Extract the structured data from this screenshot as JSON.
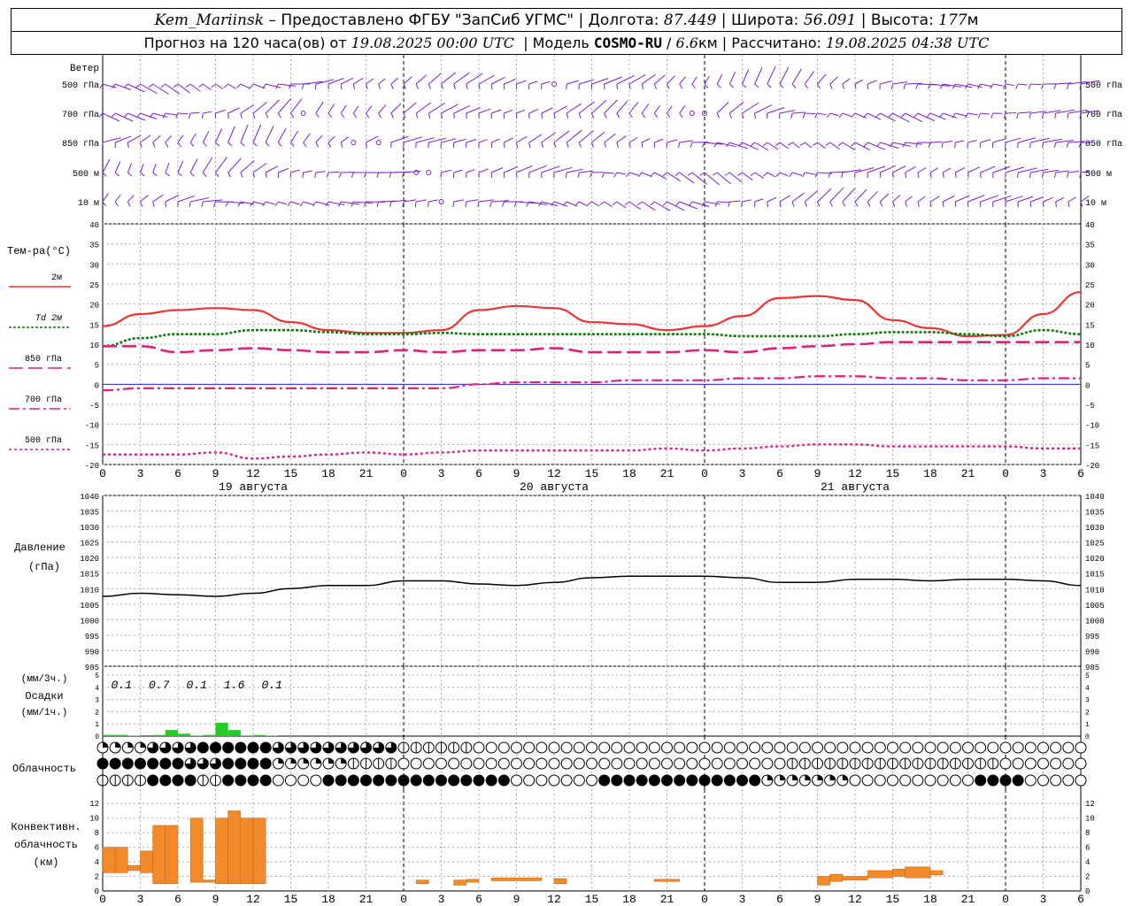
{
  "header": {
    "station": "Kem_Mariinsk",
    "dash": " – Предоставлено ФГБУ \"ЗапСиб УГМС\" | Долгота: ",
    "lon": "87.449",
    "lat_label": " | Широта: ",
    "lat": "56.091",
    "alt_label": " | Высота: ",
    "alt": "177",
    "alt_unit": "м",
    "forecast_label": "Прогноз на 120 часа(ов) от ",
    "start": "19.08.2025 00:00 UTC",
    "model_label": "  | Модель ",
    "model": "COSMO-RU",
    "res_sep": " / ",
    "res": "6.6",
    "res_unit": "км",
    "calc_label": " | Рассчитано: ",
    "calc": "19.08.2025 04:38 UTC"
  },
  "wind": {
    "title": "Ветер",
    "levels": [
      "500 гПа",
      "700 гПа",
      "850 гПа",
      "500 м",
      "10  м"
    ],
    "color": "#7a1fd0"
  },
  "x_axis": {
    "ticks": [
      "0",
      "3",
      "6",
      "9",
      "12",
      "15",
      "18",
      "21",
      "0",
      "3",
      "6",
      "9",
      "12",
      "15",
      "18",
      "21",
      "0",
      "3",
      "6",
      "9",
      "12",
      "15",
      "18",
      "21",
      "0",
      "3",
      "6"
    ],
    "dates": [
      "19 августа",
      "20 августа",
      "21 августа"
    ]
  },
  "chart_data": [
    {
      "type": "line",
      "title": "Тем-ра(°C)",
      "ylim": [
        -20,
        40
      ],
      "yticks": [
        "40",
        "35",
        "30",
        "25",
        "20",
        "15",
        "10",
        "5",
        "0",
        "-5",
        "-10",
        "-15",
        "-20"
      ],
      "x_hours": [
        0,
        3,
        6,
        9,
        12,
        15,
        18,
        21,
        24,
        27,
        30,
        33,
        36,
        39,
        42,
        45,
        48,
        51,
        54,
        57,
        60,
        63,
        66,
        69,
        72,
        75,
        78
      ],
      "series": [
        {
          "name": "2м",
          "color": "#ee3333",
          "values": [
            14.5,
            17.5,
            18.5,
            19,
            18.5,
            15.5,
            13.5,
            12.8,
            12.8,
            13.5,
            18.5,
            19.5,
            19,
            15.5,
            15,
            13.5,
            14.5,
            17,
            21.5,
            22,
            21,
            16,
            14,
            12,
            12.3,
            17.5,
            23
          ]
        },
        {
          "name": "Td 2м",
          "color": "#117711",
          "values": [
            9.5,
            11.5,
            12.5,
            12.5,
            13.5,
            13.5,
            13,
            12.5,
            12.5,
            12.8,
            12.5,
            12.5,
            12.5,
            12.5,
            12.5,
            12.5,
            12.5,
            12,
            12,
            12,
            12.5,
            13,
            13,
            12.5,
            12,
            13.5,
            12.5
          ]
        },
        {
          "name": "850 гПа",
          "color": "#e0207a",
          "values": [
            9.5,
            9.5,
            8,
            8.5,
            9,
            8.5,
            8,
            8,
            8.5,
            8,
            8.5,
            8.5,
            9,
            8,
            8,
            8,
            8.5,
            8,
            9,
            9.5,
            10,
            10.5,
            10.5,
            10.5,
            10.5,
            10.5,
            10.5
          ]
        },
        {
          "name": "700 гПа",
          "color": "#e0207a",
          "values": [
            -1.5,
            -1,
            -1,
            -1,
            -1,
            -1,
            -1,
            -1,
            -1,
            -1,
            0,
            0.5,
            0.5,
            0.5,
            1,
            1,
            1,
            1.5,
            1.5,
            2,
            2,
            1.5,
            1.5,
            1,
            1,
            1.5,
            1.5
          ]
        },
        {
          "name": "500 гПа",
          "color": "#e0207a",
          "values": [
            -17.5,
            -17.5,
            -17.5,
            -17,
            -18.5,
            -18,
            -17.5,
            -17,
            -17.5,
            -17,
            -16.5,
            -16.5,
            -16.5,
            -16.5,
            -16.5,
            -16,
            -16.5,
            -16,
            -15.5,
            -15,
            -15,
            -15.5,
            -15.5,
            -15.5,
            -15.5,
            -16,
            -16
          ]
        }
      ]
    },
    {
      "type": "line",
      "title": "Давление",
      "ylabel": "(гПа)",
      "ylim": [
        985,
        1040
      ],
      "yticks": [
        "1040",
        "1035",
        "1030",
        "1025",
        "1020",
        "1015",
        "1010",
        "1005",
        "1000",
        "995",
        "990",
        "985"
      ],
      "x_hours": [
        0,
        3,
        6,
        9,
        12,
        15,
        18,
        21,
        24,
        27,
        30,
        33,
        36,
        39,
        42,
        45,
        48,
        51,
        54,
        57,
        60,
        63,
        66,
        69,
        72,
        75,
        78
      ],
      "series": [
        {
          "name": "Давление",
          "color": "#000000",
          "values": [
            1007.5,
            1008.5,
            1008,
            1007.5,
            1008.5,
            1010,
            1011,
            1011,
            1012.5,
            1012.5,
            1011.5,
            1011,
            1012,
            1013.5,
            1014,
            1014,
            1014,
            1013.5,
            1012,
            1012,
            1013,
            1013,
            1012.5,
            1013,
            1013,
            1012.5,
            1011
          ]
        }
      ]
    },
    {
      "type": "bar",
      "title": "Осадки",
      "ylabel": "(мм/1ч.)",
      "ylabel2": "(мм/3ч.)",
      "ylim": [
        0,
        5
      ],
      "yticks": [
        "5",
        "4",
        "3",
        "2",
        "1",
        "0"
      ],
      "three_hour_totals": [
        "0.1",
        "0.7",
        "0.1",
        "1.6",
        "0.1"
      ],
      "color": "#22cc22",
      "x_hours": [
        0,
        1,
        2,
        4,
        5,
        6,
        7,
        8,
        9,
        10,
        11,
        12,
        13
      ],
      "values": [
        0.1,
        0.1,
        0.03,
        0.1,
        0.5,
        0.2,
        0.03,
        0.1,
        1.1,
        0.5,
        0.05,
        0.1,
        0.03
      ]
    },
    {
      "type": "table",
      "title": "Облачность",
      "symbols": [
        "○ 0/8",
        "◔ 1-2/8",
        "◑ 4/8",
        "◕ 6/8",
        "● 8/8",
        "◐ 3/8"
      ]
    },
    {
      "type": "bar",
      "title": "Конвективн. облачность (км)",
      "ylim": [
        0,
        13
      ],
      "yticks": [
        "12",
        "10",
        "8",
        "6",
        "4",
        "2",
        "0"
      ],
      "color": "#f08a2a",
      "bars": [
        {
          "from": 0,
          "to": 1,
          "base": 2.5,
          "top": 6
        },
        {
          "from": 1,
          "to": 2,
          "base": 2.5,
          "top": 6
        },
        {
          "from": 2,
          "to": 3,
          "base": 2.8,
          "top": 3.5
        },
        {
          "from": 3,
          "to": 4,
          "base": 2.5,
          "top": 5.5
        },
        {
          "from": 4,
          "to": 5,
          "base": 1,
          "top": 9
        },
        {
          "from": 5,
          "to": 6,
          "base": 1,
          "top": 9
        },
        {
          "from": 7,
          "to": 8,
          "base": 1.2,
          "top": 10
        },
        {
          "from": 8,
          "to": 9,
          "base": 1.2,
          "top": 1.5
        },
        {
          "from": 9,
          "to": 10,
          "base": 1,
          "top": 10
        },
        {
          "from": 10,
          "to": 11,
          "base": 1,
          "top": 11
        },
        {
          "from": 11,
          "to": 12,
          "base": 1,
          "top": 10
        },
        {
          "from": 12,
          "to": 13,
          "base": 1,
          "top": 10
        },
        {
          "from": 25,
          "to": 26,
          "base": 1,
          "top": 1.5
        },
        {
          "from": 28,
          "to": 29,
          "base": 0.8,
          "top": 1.5
        },
        {
          "from": 29,
          "to": 30,
          "base": 1.2,
          "top": 1.6
        },
        {
          "from": 31,
          "to": 35,
          "base": 1.4,
          "top": 1.8
        },
        {
          "from": 36,
          "to": 37,
          "base": 1,
          "top": 1.7
        },
        {
          "from": 44,
          "to": 46,
          "base": 1.3,
          "top": 1.6
        },
        {
          "from": 57,
          "to": 58,
          "base": 0.8,
          "top": 2
        },
        {
          "from": 58,
          "to": 59,
          "base": 1.3,
          "top": 2.3
        },
        {
          "from": 59,
          "to": 61,
          "base": 1.5,
          "top": 2
        },
        {
          "from": 61,
          "to": 63,
          "base": 1.8,
          "top": 2.8
        },
        {
          "from": 63,
          "to": 64,
          "base": 2,
          "top": 3
        },
        {
          "from": 64,
          "to": 66,
          "base": 1.8,
          "top": 3.3
        },
        {
          "from": 66,
          "to": 67,
          "base": 2.2,
          "top": 2.8
        }
      ]
    }
  ]
}
